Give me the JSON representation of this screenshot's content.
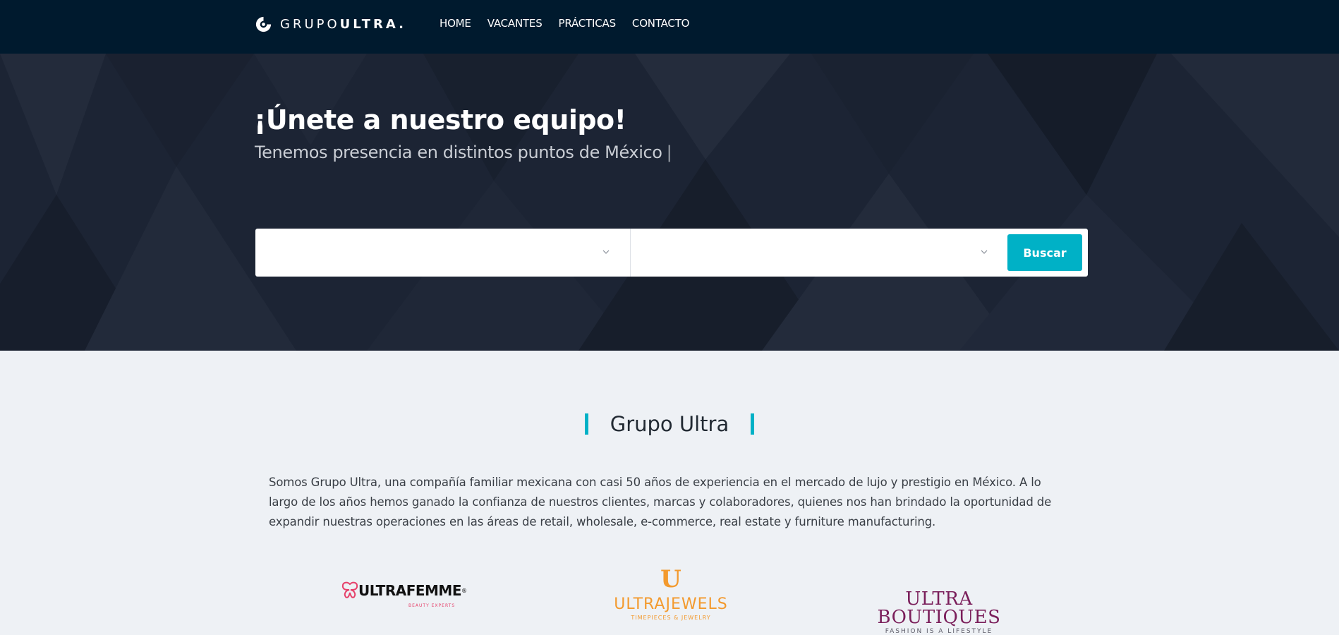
{
  "header": {
    "logo": {
      "light": "GRUPO",
      "bold": "ULTRA."
    },
    "nav": [
      "HOME",
      "VACANTES",
      "PRÁCTICAS",
      "CONTACTO"
    ]
  },
  "hero": {
    "title": "¡Únete a nuestro equipo!",
    "subtitle": "Tenemos presencia en distintos puntos de México",
    "cursor": "|",
    "search": {
      "select1_value": "",
      "select2_value": "",
      "button_label": "Buscar"
    }
  },
  "about": {
    "title": "Grupo Ultra",
    "text": "Somos Grupo Ultra, una compañía familiar mexicana con casi 50 años de experiencia en el mercado de lujo y prestigio en México. A lo largo de los años hemos ganado la confianza de nuestros clientes, marcas y colaboradores, quienes nos han brindado la oportunidad de expandir nuestras operaciones en las áreas de retail, wholesale, e-commerce, real estate y furniture manufacturing."
  },
  "brands": {
    "ultrafemme": {
      "name": "ULTRAFEMME",
      "tag": "BEAUTY EXPERTS"
    },
    "ultrajewels": {
      "name": "ULTRAJEWELS",
      "tag": "TIMEPIECES & JEWELRY"
    },
    "ultraboutiques": {
      "name": "ULTRA BOUTIQUES",
      "tag": "FASHION IS A LIFESTYLE"
    }
  },
  "colors": {
    "header_bg": "#001a2e",
    "hero_bg": "#1c2434",
    "accent": "#00b1c6",
    "page_bg": "#eef1f5"
  },
  "icons": [
    "logo-icon",
    "chevron-down-icon"
  ]
}
